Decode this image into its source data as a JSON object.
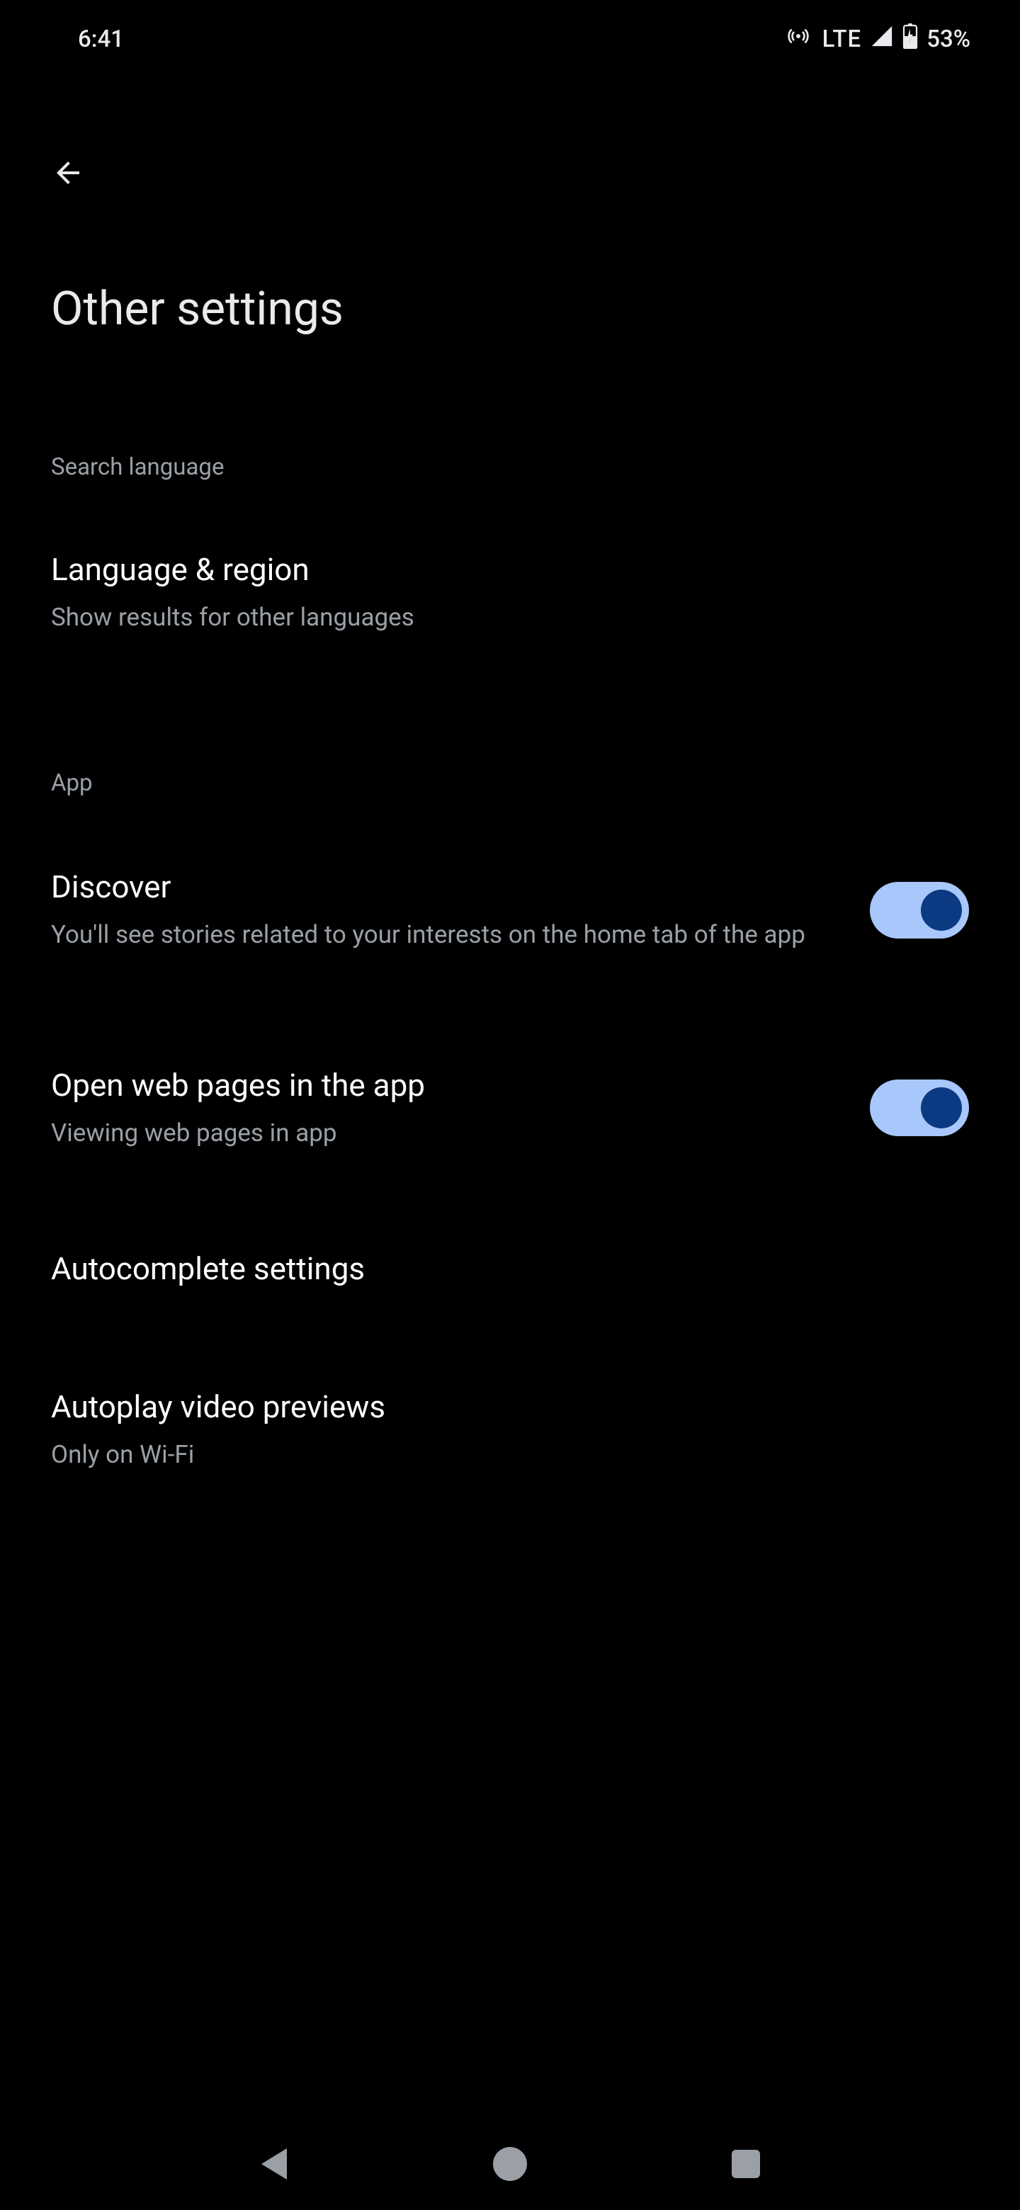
{
  "status": {
    "time": "6:41",
    "lte": "LTE",
    "battery_percent": "53%"
  },
  "header": {
    "title": "Other settings"
  },
  "sections": {
    "search_language": {
      "header": "Search language",
      "language_region": {
        "title": "Language & region",
        "sub": "Show results for other languages"
      }
    },
    "app": {
      "header": "App",
      "discover": {
        "title": "Discover",
        "sub": "You'll see stories related to your interests on the home tab of the app",
        "enabled": true
      },
      "open_web": {
        "title": "Open web pages in the app",
        "sub": "Viewing web pages in app",
        "enabled": true
      },
      "autocomplete": {
        "title": "Autocomplete settings"
      },
      "autoplay": {
        "title": "Autoplay video previews",
        "sub": "Only on Wi-Fi"
      }
    }
  }
}
